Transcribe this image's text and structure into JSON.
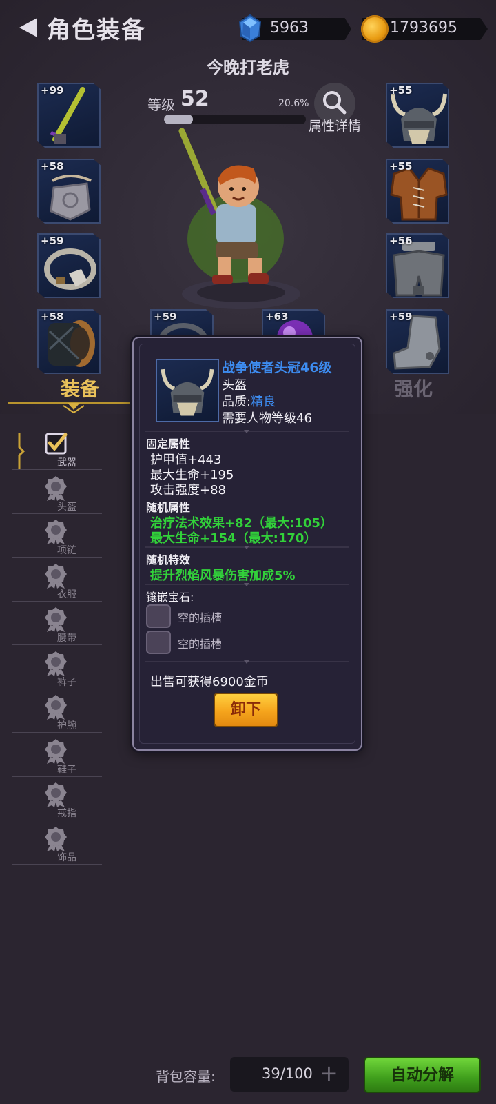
{
  "header": {
    "back_icon": "back-arrow-icon",
    "title": "角色装备",
    "gems": "5963",
    "gem_icon": "blue-gem-icon",
    "coins": "1793695",
    "coin_icon": "gold-coin-icon"
  },
  "player": {
    "name": "今晚打老虎",
    "level_label": "等级",
    "level": "52",
    "exp_percent_text": "20.6%",
    "exp_fraction": 0.206,
    "detail_label": "属性详情",
    "detail_icon": "magnifier-icon"
  },
  "slots": {
    "weapon": "+99",
    "necklace": "+58",
    "ring": "+59",
    "bracer": "+58",
    "ring2": "+59",
    "orb": "+63",
    "helmet": "+55",
    "armor": "+55",
    "pants": "+56",
    "boots": "+59"
  },
  "tabs": {
    "equip": "装备",
    "enhance": "强化"
  },
  "categories": [
    {
      "label": "武器",
      "icon": "checkbox-checked-icon"
    },
    {
      "label": "头盔",
      "icon": "badge-icon"
    },
    {
      "label": "项链",
      "icon": "badge-icon"
    },
    {
      "label": "衣服",
      "icon": "badge-icon"
    },
    {
      "label": "腰带",
      "icon": "badge-icon"
    },
    {
      "label": "裤子",
      "icon": "badge-icon"
    },
    {
      "label": "护腕",
      "icon": "badge-icon"
    },
    {
      "label": "鞋子",
      "icon": "badge-icon"
    },
    {
      "label": "戒指",
      "icon": "badge-icon"
    },
    {
      "label": "饰品",
      "icon": "badge-icon"
    }
  ],
  "popup": {
    "item_name": "战争使者头冠46级",
    "item_type": "头盔",
    "quality_label": "品质:",
    "quality_value": "精良",
    "requirement": "需要人物等级46",
    "fixed_title": "固定属性",
    "fixed_stats": [
      "护甲值+443",
      "最大生命+195",
      "攻击强度+88"
    ],
    "random_title": "随机属性",
    "random_stats": [
      "治疗法术效果+82（最大:105）",
      "最大生命+154（最大:170）"
    ],
    "effect_title": "随机特效",
    "effect": "提升烈焰风暴伤害加成5%",
    "gem_title": "镶嵌宝石:",
    "gem_slots": [
      "空的插槽",
      "空的插槽"
    ],
    "sell_text": "出售可获得6900金币",
    "unequip": "卸下"
  },
  "bottom": {
    "bag_label": "背包容量:",
    "bag_value": "39/100",
    "plus_icon": "plus-icon",
    "auto_decompose": "自动分解"
  },
  "colors": {
    "accent_gold": "#e9c15a",
    "item_name_blue": "#3d8cf0",
    "stat_green": "#32d13a"
  }
}
